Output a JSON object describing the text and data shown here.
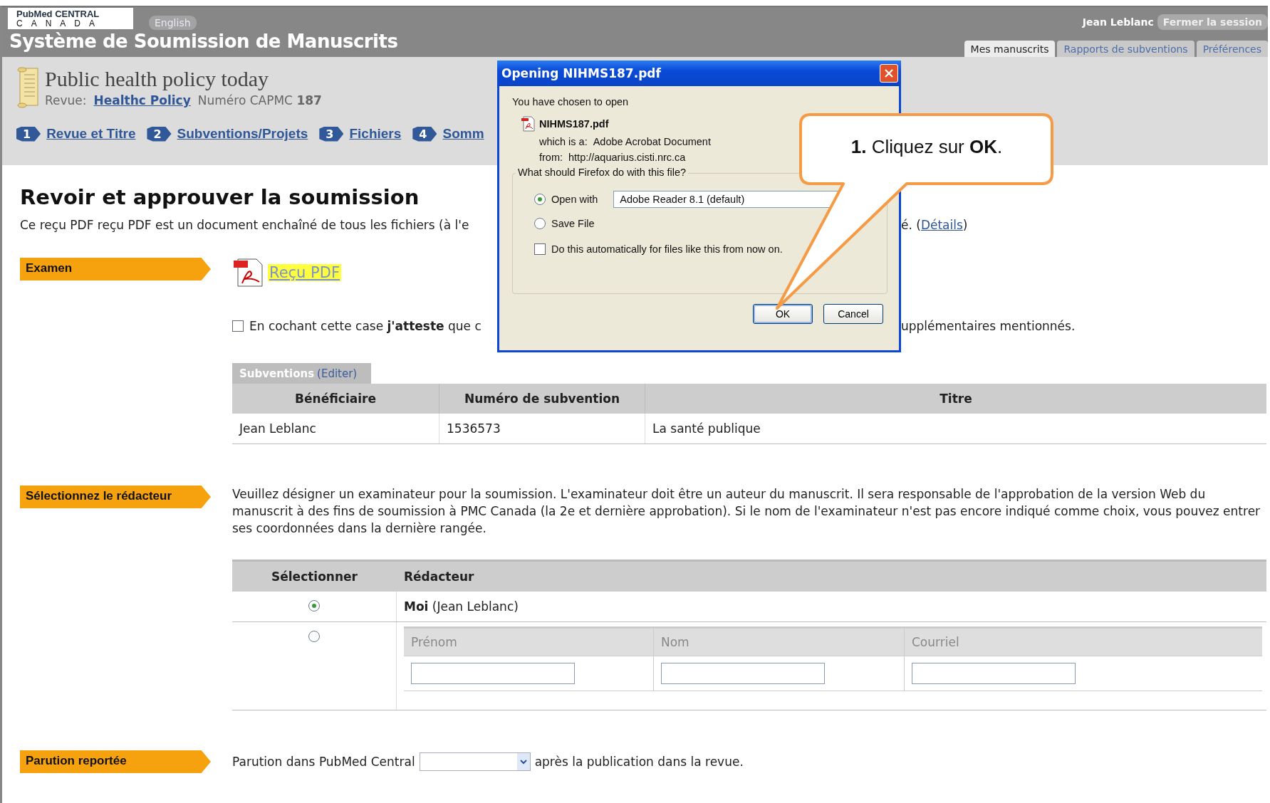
{
  "header": {
    "logo_top": "PubMed CENTRAL",
    "logo_bottom": "CANADA",
    "language_button": "English",
    "title": "Système de Soumission de Manuscrits",
    "user": "Jean Leblanc",
    "logout_button": "Fermer la session",
    "tabs": [
      {
        "label": "Mes manuscrits",
        "selected": true
      },
      {
        "label": "Rapports de subventions",
        "selected": false
      },
      {
        "label": "Préférences",
        "selected": false
      }
    ]
  },
  "journal": {
    "title": "Public health policy today",
    "revue_label": "Revue:",
    "revue_link": "Healthc Policy",
    "number": "Numéro CAPMC **187**"
  },
  "steps": [
    {
      "number": "1",
      "label": "Revue et Titre"
    },
    {
      "number": "2",
      "label": "Subventions/Projets"
    },
    {
      "number": "3",
      "label": "Fichiers"
    },
    {
      "number": "4",
      "label": "Somm"
    }
  ],
  "review": {
    "heading": "Revoir et approuver la soumission",
    "intro_left": "Ce reçu PDF reçu PDF est un document enchaîné de tous les fichiers (à l'e",
    "intro_right": "é. (",
    "details_link": "Détails",
    "intro_end": ")"
  },
  "examen": {
    "label": "Examen",
    "pdf_link": "Reçu PDF",
    "attest": {
      "checked": false,
      "left": "En cochant cette case **j'atteste** que c",
      "right": "upplémentaires mentionnés."
    }
  },
  "grants": {
    "tab_title": "Subventions",
    "edit_link": "(Editer)",
    "columns": [
      "Bénéficiaire",
      "Numéro de subvention",
      "Titre"
    ],
    "rows": [
      [
        "Jean Leblanc",
        "1536573",
        "La santé publique"
      ]
    ]
  },
  "editor": {
    "label": "Sélectionnez le rédacteur",
    "text": "Veuillez désigner un examinateur pour la soumission. L'examinateur doit être un auteur du manuscrit. Il sera responsable de l'approbation de la version Web du manuscrit à des fins de soumission à PMC Canada (la 2e et dernière approbation). Si le nom de l'examinateur n'est pas encore indiqué comme choix, vous pouvez entrer ses coordonnées dans la dernière rangée.",
    "columns": [
      "Sélectionner",
      "Rédacteur"
    ],
    "rows": [
      {
        "kind": "self",
        "selected": true,
        "name": "**Moi** (Jean Leblanc)"
      },
      {
        "kind": "new",
        "selected": false,
        "fields": [
          "Prénom",
          "Nom",
          "Courriel"
        ]
      }
    ]
  },
  "deferred": {
    "label": "Parution reportée",
    "before": "Parution dans PubMed Central",
    "after": "après la publication dans la revue."
  },
  "dialog": {
    "title": "Opening NIHMS187.pdf",
    "intro": "You have chosen to open",
    "filename": "NIHMS187.pdf",
    "type_label": "which is a:",
    "type": "Adobe Acrobat Document",
    "from_label": "from:",
    "from": "http://aquarius.cisti.nrc.ca",
    "question": "What should Firefox do with this file?",
    "options": [
      {
        "label": "Open with",
        "selected": true,
        "app": "Adobe Reader 8.1 (default)"
      },
      {
        "label": "Save File",
        "selected": false
      }
    ],
    "auto": {
      "label": "Do this automatically for files like this from now on.",
      "checked": false
    },
    "buttons": [
      "OK",
      "Cancel"
    ]
  },
  "callout": {
    "text": "**1.** Cliquez sur **OK**."
  }
}
